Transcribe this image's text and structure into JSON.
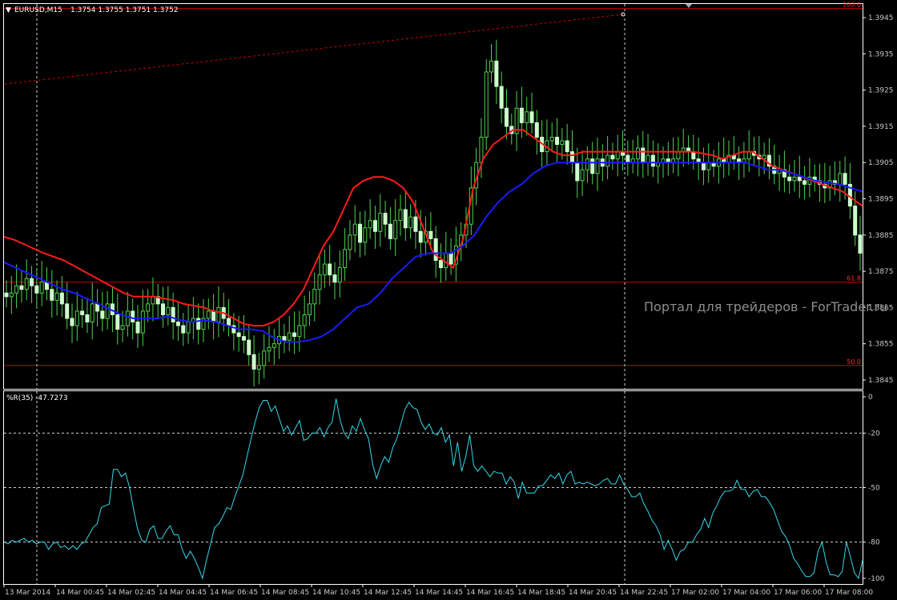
{
  "header": {
    "menu_glyph": "▼",
    "symbol": "EURUSD,M15",
    "ohlc": "1.3754 1.3755 1.3751 1.3752"
  },
  "watermark": "Портал для трейдеров - ForTrader.ru",
  "indicator": {
    "label": "%R(35) -47.7273",
    "levels": [
      0,
      -20,
      -50,
      -80,
      -100
    ]
  },
  "fib_levels": [
    {
      "label": "100.0",
      "price": 1.39475
    },
    {
      "label": "61.8",
      "price": 1.3872
    },
    {
      "label": "50.0",
      "price": 1.3849
    }
  ],
  "colors": {
    "bull": "#ccffcc",
    "bear": "#ccffcc",
    "wick": "#4fd34f",
    "ma_fast": "#ff1a1a",
    "ma_slow": "#1a1aff",
    "wr_line": "#34d8e8",
    "fib": "#cc0000",
    "grid": "#cfcfcf"
  },
  "chart_data": {
    "type": "candlestick",
    "symbol": "EURUSD",
    "timeframe": "M15",
    "ylim": [
      1.3841,
      1.3951
    ],
    "y_ticks": [
      1.3945,
      1.3935,
      1.3925,
      1.3915,
      1.3905,
      1.3895,
      1.3885,
      1.3875,
      1.3865,
      1.3855,
      1.3845
    ],
    "x_ticks": [
      "13 Mar 2014",
      "14 Mar 00:45",
      "14 Mar 02:45",
      "14 Mar 04:45",
      "14 Mar 06:45",
      "14 Mar 08:45",
      "14 Mar 10:45",
      "14 Mar 12:45",
      "14 Mar 14:45",
      "14 Mar 16:45",
      "14 Mar 18:45",
      "14 Mar 20:45",
      "14 Mar 22:45",
      "17 Mar 02:00",
      "17 Mar 04:00",
      "17 Mar 06:00",
      "17 Mar 08:00"
    ],
    "candles_close": [
      1.3868,
      1.3869,
      1.3871,
      1.387,
      1.3873,
      1.3871,
      1.3869,
      1.3872,
      1.387,
      1.3867,
      1.3869,
      1.3866,
      1.3862,
      1.386,
      1.3864,
      1.3863,
      1.3861,
      1.3866,
      1.3864,
      1.3862,
      1.3866,
      1.3863,
      1.3859,
      1.386,
      1.3864,
      1.3861,
      1.3858,
      1.3864,
      1.3866,
      1.3868,
      1.3866,
      1.3863,
      1.3865,
      1.3861,
      1.386,
      1.3858,
      1.3861,
      1.3862,
      1.3859,
      1.3862,
      1.3864,
      1.3861,
      1.3865,
      1.3862,
      1.386,
      1.3858,
      1.3857,
      1.3856,
      1.3852,
      1.3848,
      1.3849,
      1.3853,
      1.3854,
      1.3855,
      1.3857,
      1.3856,
      1.3858,
      1.3857,
      1.386,
      1.3863,
      1.3866,
      1.387,
      1.3874,
      1.3877,
      1.3874,
      1.3872,
      1.3876,
      1.3881,
      1.3885,
      1.3888,
      1.3883,
      1.3887,
      1.3889,
      1.3886,
      1.3891,
      1.3888,
      1.3884,
      1.3889,
      1.3892,
      1.3887,
      1.389,
      1.3886,
      1.3883,
      1.3886,
      1.3884,
      1.3878,
      1.3876,
      1.388,
      1.3877,
      1.3882,
      1.3885,
      1.3888,
      1.3898,
      1.3905,
      1.3912,
      1.393,
      1.3933,
      1.3926,
      1.392,
      1.3915,
      1.3913,
      1.392,
      1.3916,
      1.3919,
      1.3916,
      1.3912,
      1.3908,
      1.3911,
      1.3912,
      1.391,
      1.3911,
      1.3908,
      1.3905,
      1.39,
      1.3903,
      1.3906,
      1.3902,
      1.3906,
      1.3904,
      1.3907,
      1.3906,
      1.3908,
      1.3907,
      1.3905,
      1.3906,
      1.3909,
      1.3905,
      1.3907,
      1.3904,
      1.3905,
      1.3906,
      1.3905,
      1.3906,
      1.3908,
      1.3909,
      1.3908,
      1.3906,
      1.3905,
      1.3903,
      1.3905,
      1.3904,
      1.3906,
      1.3905,
      1.3907,
      1.3906,
      1.3905,
      1.3906,
      1.3908,
      1.3907,
      1.3906,
      1.3907,
      1.3904,
      1.3902,
      1.3903,
      1.3901,
      1.39,
      1.3901,
      1.39,
      1.3899,
      1.3901,
      1.39,
      1.3899,
      1.3898,
      1.39,
      1.3899,
      1.3902,
      1.3899,
      1.3893,
      1.3885,
      1.388
    ],
    "series": [
      {
        "name": "MA fast",
        "values": [
          1.38845,
          1.38837,
          1.38825,
          1.38812,
          1.388,
          1.3879,
          1.3878,
          1.38765,
          1.3875,
          1.38735,
          1.3872,
          1.38705,
          1.3869,
          1.3868,
          1.3868,
          1.3868,
          1.38675,
          1.3867,
          1.3866,
          1.38655,
          1.3865,
          1.3864,
          1.38635,
          1.3862,
          1.38605,
          1.386,
          1.386,
          1.3861,
          1.3863,
          1.3866,
          1.387,
          1.3876,
          1.3882,
          1.3886,
          1.3892,
          1.3898,
          1.39,
          1.3901,
          1.3901,
          1.39,
          1.3898,
          1.3894,
          1.3887,
          1.388,
          1.3878,
          1.3876,
          1.3884,
          1.3898,
          1.3906,
          1.391,
          1.3912,
          1.3914,
          1.3914,
          1.3912,
          1.391,
          1.3908,
          1.3907,
          1.3907,
          1.3908,
          1.3908,
          1.3908,
          1.3908,
          1.3908,
          1.3908,
          1.3908,
          1.3908,
          1.3908,
          1.3908,
          1.3908,
          1.3908,
          1.39075,
          1.3907,
          1.3906,
          1.3907,
          1.3908,
          1.3908,
          1.3906,
          1.3904,
          1.3903,
          1.3902,
          1.3901,
          1.39,
          1.3899,
          1.3898,
          1.3897,
          1.3895,
          1.3893
        ]
      },
      {
        "name": "MA slow",
        "values": [
          1.38775,
          1.3876,
          1.38745,
          1.3873,
          1.38715,
          1.387,
          1.3869,
          1.38675,
          1.3866,
          1.38645,
          1.3863,
          1.3862,
          1.3862,
          1.3862,
          1.38625,
          1.38615,
          1.3861,
          1.38615,
          1.3861,
          1.386,
          1.3859,
          1.3859,
          1.38585,
          1.38565,
          1.38555,
          1.38555,
          1.3856,
          1.3857,
          1.3859,
          1.3862,
          1.3865,
          1.3866,
          1.3869,
          1.3873,
          1.3876,
          1.3879,
          1.388,
          1.388,
          1.388,
          1.3882,
          1.3885,
          1.389,
          1.3894,
          1.3897,
          1.3899,
          1.3902,
          1.3904,
          1.3905,
          1.3905,
          1.3905,
          1.3905,
          1.3905,
          1.3905,
          1.3905,
          1.3905,
          1.3905,
          1.3905,
          1.3905,
          1.3905,
          1.3905,
          1.3905,
          1.3905,
          1.3905,
          1.3905,
          1.3904,
          1.3903,
          1.3903,
          1.3902,
          1.3901,
          1.39,
          1.38995,
          1.3899,
          1.3898,
          1.3897
        ]
      }
    ],
    "williams_r": [
      -80,
      -81,
      -79,
      -80,
      -79,
      -78,
      -80,
      -79,
      -81,
      -80,
      -80,
      -84,
      -81,
      -80,
      -83,
      -82,
      -84,
      -82,
      -84,
      -81,
      -80,
      -76,
      -72,
      -70,
      -61,
      -60,
      -59,
      -40,
      -40,
      -44,
      -42,
      -50,
      -62,
      -73,
      -79,
      -80,
      -73,
      -71,
      -78,
      -78,
      -74,
      -71,
      -76,
      -76,
      -84,
      -89,
      -85,
      -89,
      -94,
      -100,
      -90,
      -81,
      -72,
      -70,
      -66,
      -61,
      -62,
      -55,
      -49,
      -43,
      -33,
      -23,
      -14,
      -6,
      -2,
      -2,
      -8,
      -5,
      -12,
      -19,
      -16,
      -21,
      -17,
      -13,
      -24,
      -23,
      -20,
      -20,
      -17,
      -22,
      -17,
      -14,
      -1,
      -13,
      -20,
      -23,
      -16,
      -19,
      -12,
      -18,
      -23,
      -37,
      -45,
      -38,
      -33,
      -36,
      -28,
      -23,
      -15,
      -7,
      -3,
      -6,
      -7,
      -14,
      -18,
      -15,
      -20,
      -21,
      -17,
      -25,
      -21,
      -38,
      -25,
      -41,
      -33,
      -21,
      -38,
      -41,
      -38,
      -41,
      -44,
      -41,
      -42,
      -42,
      -48,
      -44,
      -47,
      -56,
      -47,
      -53,
      -53,
      -53,
      -49,
      -49,
      -46,
      -43,
      -45,
      -42,
      -48,
      -43,
      -41,
      -48,
      -47,
      -48,
      -47,
      -48,
      -49,
      -48,
      -46,
      -45,
      -48,
      -48,
      -43,
      -48,
      -51,
      -55,
      -55,
      -53,
      -59,
      -63,
      -68,
      -71,
      -76,
      -84,
      -79,
      -84,
      -90,
      -85,
      -84,
      -80,
      -80,
      -76,
      -73,
      -67,
      -72,
      -64,
      -60,
      -55,
      -52,
      -52,
      -51,
      -46,
      -51,
      -51,
      -55,
      -52,
      -51,
      -55,
      -55,
      -58,
      -62,
      -68,
      -74,
      -77,
      -82,
      -89,
      -92,
      -96,
      -99,
      -99,
      -97,
      -85,
      -80,
      -91,
      -98,
      -98,
      -99,
      -96,
      -80,
      -88,
      -97,
      -100,
      -90
    ]
  }
}
